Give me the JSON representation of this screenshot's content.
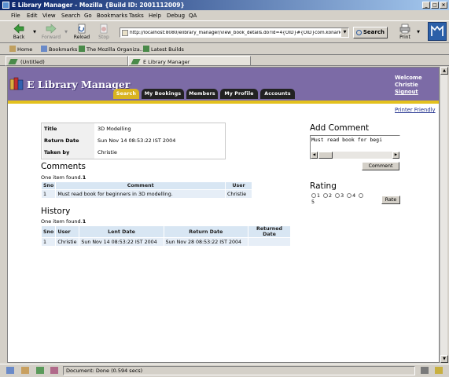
{
  "window": {
    "title": "E Library Manager - Mozilla {Build ID: 2001112009}",
    "controls": [
      "_",
      "□",
      "×"
    ]
  },
  "menu": {
    "items": [
      "File",
      "Edit",
      "View",
      "Search",
      "Go",
      "Bookmarks",
      "Tasks",
      "Help",
      "Debug",
      "QA"
    ]
  },
  "navbar": {
    "back": "Back",
    "forward": "Forward",
    "reload": "Reload",
    "stop": "Stop",
    "url": "http://localhost:8080/elibrary_manager/view_book_details.do?id=4{OID}#{OID}com.konarkd",
    "search": "Search",
    "print": "Print"
  },
  "bookmarks": {
    "items": [
      "Home",
      "Bookmarks",
      "The Mozilla Organiza...",
      "Latest Builds"
    ]
  },
  "tabs": {
    "items": [
      "(Untitled)",
      "E Library Manager"
    ]
  },
  "app": {
    "brand": "E Library Manager",
    "nav": [
      "Search",
      "My Bookings",
      "Members",
      "My Profile",
      "Accounts"
    ],
    "active_nav": "Search",
    "welcome_label": "Welcome",
    "user": "Christie",
    "signout": "Signout",
    "printer_friendly": "Printer Friendly"
  },
  "book": {
    "rows": [
      {
        "label": "Title",
        "value": "3D Modelling"
      },
      {
        "label": "Return Date",
        "value": "Sun Nov 14 08:53:22 IST 2004"
      },
      {
        "label": "Taken by",
        "value": "Christie"
      }
    ]
  },
  "comments": {
    "heading": "Comments",
    "found_prefix": "One item found.",
    "found_count": "1",
    "columns": [
      "Sno",
      "Comment",
      "User"
    ],
    "rows": [
      {
        "sno": "1",
        "comment": "Must read book for beginners in 3D modelling.",
        "user": "Christie"
      }
    ]
  },
  "history": {
    "heading": "History",
    "found_prefix": "One item found.",
    "found_count": "1",
    "columns": [
      "Sno",
      "User",
      "Lent Date",
      "Return Date",
      "Returned Date"
    ],
    "rows": [
      {
        "sno": "1",
        "user": "Christie",
        "lent": "Sun Nov 14 08:53:22 IST 2004",
        "return": "Sun Nov 28 08:53:22 IST 2004",
        "returned": ""
      }
    ]
  },
  "add_comment": {
    "heading": "Add Comment",
    "text": "Must read book for begi",
    "button": "Comment"
  },
  "rating": {
    "heading": "Rating",
    "options": [
      "1",
      "2",
      "3",
      "4",
      "5"
    ],
    "button": "Rate"
  },
  "status": {
    "text": "Document: Done (0.594 secs)"
  }
}
